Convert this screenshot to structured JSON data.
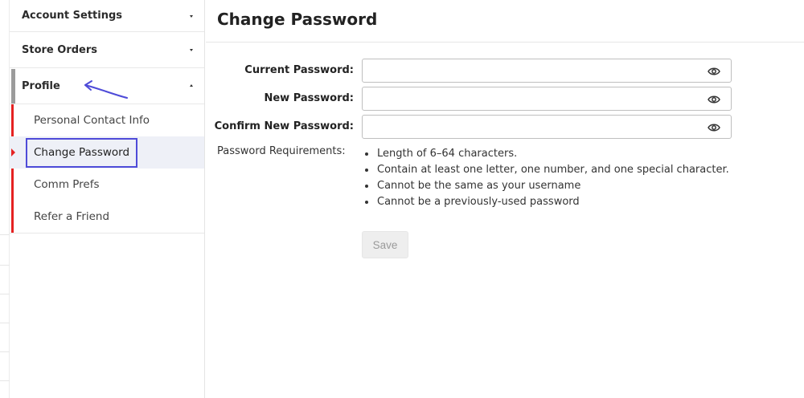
{
  "sidebar": {
    "sections": [
      {
        "label": "Account Settings",
        "expanded": false
      },
      {
        "label": "Store Orders",
        "expanded": false
      },
      {
        "label": "Profile",
        "expanded": true
      }
    ],
    "profile_items": [
      {
        "label": "Personal Contact Info"
      },
      {
        "label": "Change Password",
        "selected": true
      },
      {
        "label": "Comm Prefs"
      },
      {
        "label": "Refer a Friend"
      }
    ]
  },
  "main": {
    "title": "Change Password",
    "fields": [
      {
        "label": "Current Password:",
        "value": "",
        "icon": "eye-icon"
      },
      {
        "label": "New Password:",
        "value": "",
        "icon": "eye-icon"
      },
      {
        "label": "Confirm New Password:",
        "value": "",
        "icon": "eye-icon"
      }
    ],
    "requirements_label": "Password Requirements:",
    "requirements": [
      "Length of 6–64 characters.",
      "Contain at least one letter, one number, and one special character.",
      "Cannot be the same as your username",
      "Cannot be a previously-used password"
    ],
    "save_label": "Save"
  },
  "colors": {
    "accent_red": "#e52222",
    "highlight_box": "#4e4bd8",
    "active_bar": "#9b9b9b"
  }
}
